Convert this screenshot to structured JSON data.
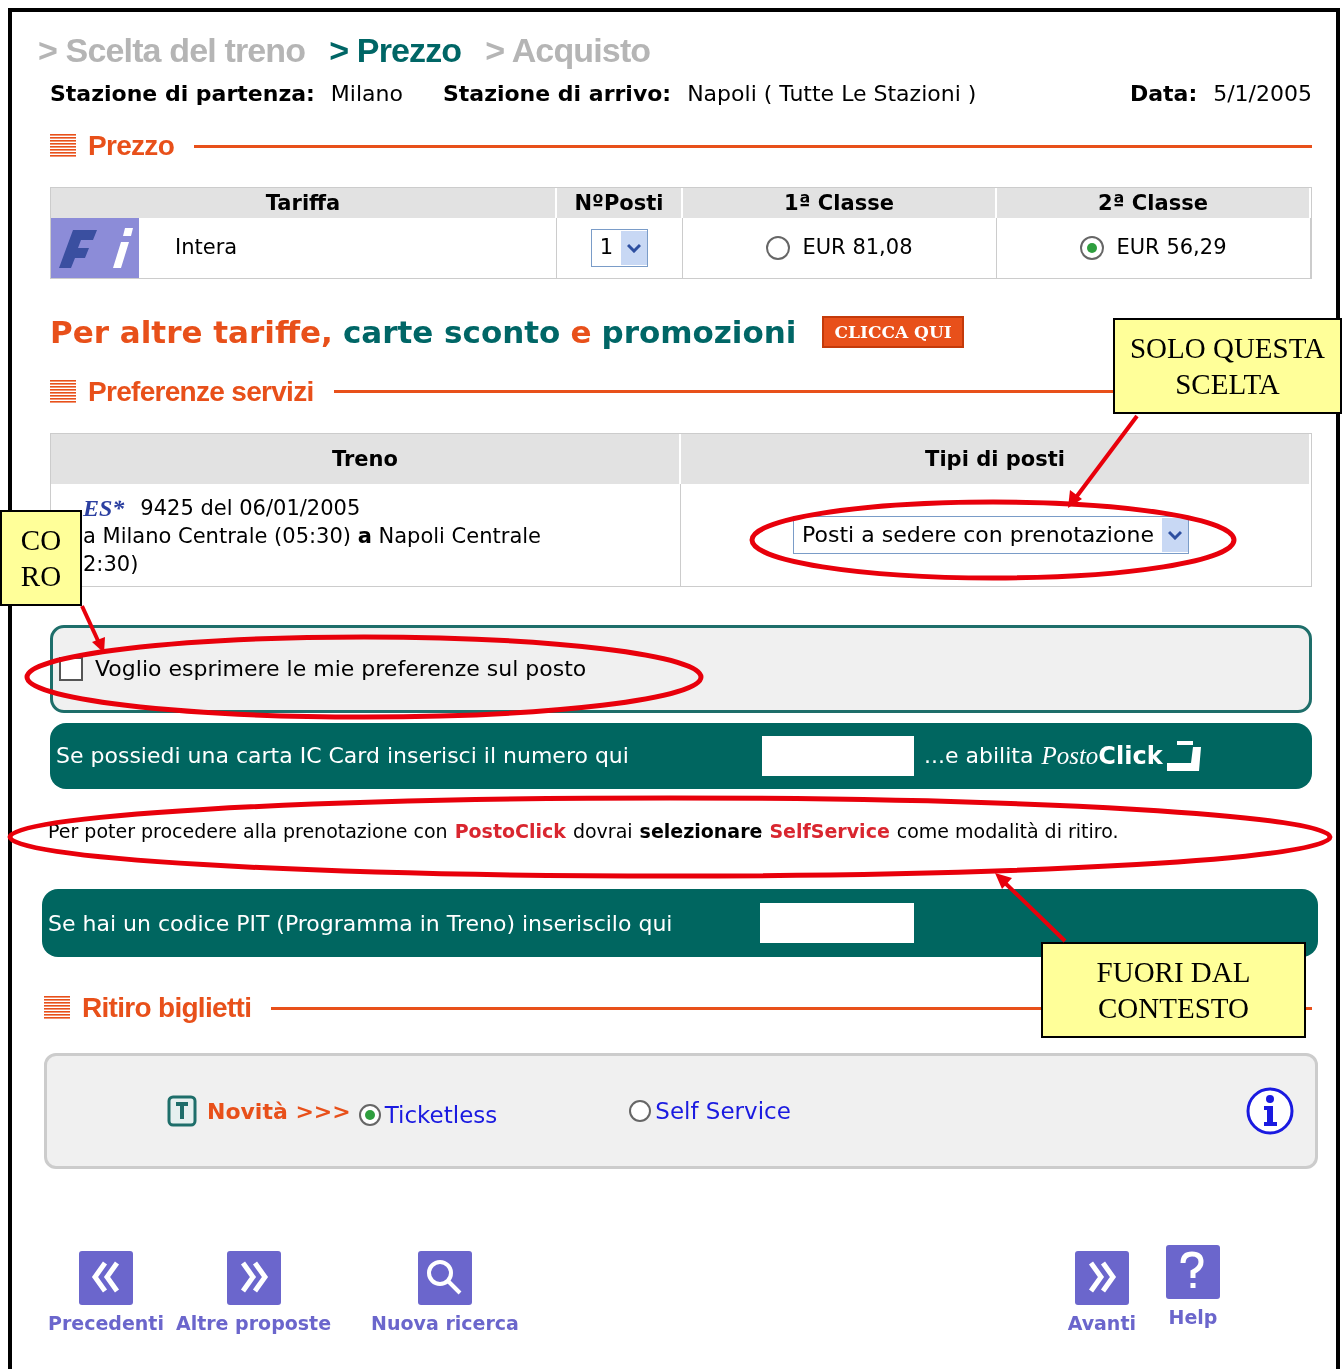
{
  "breadcrumb": [
    {
      "label": "> Scelta del treno",
      "selected": false
    },
    {
      "label": "> Prezzo",
      "selected": true
    },
    {
      "label": "> Acquisto",
      "selected": false
    }
  ],
  "trip": [
    {
      "label": "Stazione di partenza:",
      "value": "Milano"
    },
    {
      "label": "Stazione di arrivo:",
      "value": "Napoli ( Tutte Le Stazioni )"
    },
    {
      "label": "Data:",
      "value": "5/1/2005"
    }
  ],
  "prezzo": {
    "title": "Prezzo",
    "columns": [
      "Tariffa",
      "NºPosti",
      "1ª Classe",
      "2ª Classe"
    ],
    "fare": "Intera",
    "seats": "1",
    "classes": [
      {
        "label": "EUR 81,08",
        "selected": false
      },
      {
        "label": "EUR 56,29",
        "selected": true
      }
    ]
  },
  "promo": {
    "parts": [
      {
        "text": "Per altre tariffe,",
        "color": "#e8501a"
      },
      {
        "text": "carte sconto",
        "color": "#006666"
      },
      {
        "text": "e",
        "color": "#e8501a"
      },
      {
        "text": "promozioni",
        "color": "#006666"
      }
    ],
    "button": "CLICCA QUI"
  },
  "services": {
    "title": "Preferenze servizi",
    "columns": [
      "Treno",
      "Tipi di posti"
    ],
    "train_badge": "ES*",
    "train_lines": [
      "9425  del 06/01/2005",
      "a  Milano Centrale (05:30) **a**  Napoli Centrale",
      "2:30)"
    ],
    "seat_type": "Posti a sedere con prenotazione"
  },
  "seat_preference": {
    "label": "Voglio esprimere le mie preferenze sul posto",
    "checked": false
  },
  "ic_card": {
    "label": "Se possiedi una carta IC Card inserisci il numero qui",
    "suffix": "...e abilita",
    "logo_a": "Posto",
    "logo_b": "Click"
  },
  "notice": [
    {
      "text": "Per poter procedere alla prenotazione con",
      "kind": "plain"
    },
    {
      "text": "PostoClick",
      "kind": "red"
    },
    {
      "text": "dovrai",
      "kind": "plain"
    },
    {
      "text": "selezionare",
      "kind": "bold"
    },
    {
      "text": "SelfService",
      "kind": "red"
    },
    {
      "text": "come modalità di ritiro.",
      "kind": "plain"
    }
  ],
  "pit": {
    "label": "Se hai un codice PIT (Programma in Treno) inseriscilo qui"
  },
  "ritiro": {
    "title": "Ritiro biglietti",
    "novita": "Novità >>>",
    "options": [
      {
        "label": "Ticketless",
        "selected": true
      },
      {
        "label": "Self Service",
        "selected": false
      }
    ]
  },
  "nav_left": [
    {
      "label": "Precedenti",
      "kind": "back"
    },
    {
      "label": "Altre proposte",
      "kind": "next"
    },
    {
      "label": "Nuova ricerca",
      "kind": "search"
    }
  ],
  "nav_right": [
    {
      "label": "Avanti",
      "kind": "next"
    },
    {
      "label": "Help",
      "kind": "help"
    }
  ],
  "callouts": [
    {
      "lines": [
        "SOLO QUESTA",
        "SCELTA"
      ],
      "kind": "right"
    },
    {
      "lines": [
        "CO",
        "RO"
      ],
      "kind": "left"
    },
    {
      "lines": [
        "FUORI DAL",
        "CONTESTO"
      ],
      "kind": "bottom"
    }
  ]
}
